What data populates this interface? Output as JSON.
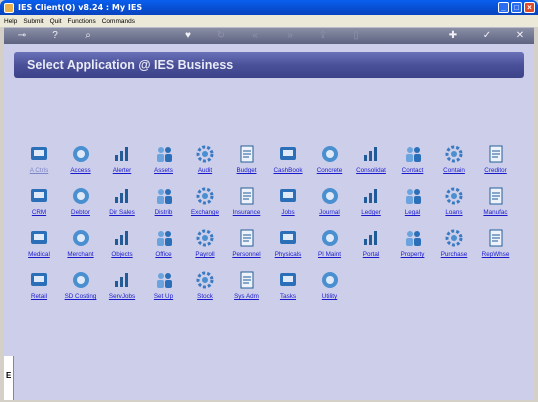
{
  "window": {
    "title": "IES Client(Q) v8.24 : My IES"
  },
  "menu": {
    "items": [
      "Help",
      "Submit",
      "Quit",
      "Functions",
      "Commands"
    ]
  },
  "header": {
    "title": "Select Application @ IES Business"
  },
  "side": {
    "label": "E"
  },
  "apps": [
    {
      "label": "A Ctrls",
      "icon": "a-ctrls-icon",
      "enabled": false
    },
    {
      "label": "Access",
      "icon": "access-icon",
      "enabled": true
    },
    {
      "label": "Alerter",
      "icon": "alerter-icon",
      "enabled": true
    },
    {
      "label": "Assets",
      "icon": "assets-icon",
      "enabled": true
    },
    {
      "label": "Audit",
      "icon": "audit-icon",
      "enabled": true
    },
    {
      "label": "Budget",
      "icon": "budget-icon",
      "enabled": true
    },
    {
      "label": "CashBook",
      "icon": "cashbook-icon",
      "enabled": true
    },
    {
      "label": "Concrete",
      "icon": "concrete-icon",
      "enabled": true
    },
    {
      "label": "Consolidat",
      "icon": "consolidat-icon",
      "enabled": true
    },
    {
      "label": "Contact",
      "icon": "contact-icon",
      "enabled": true
    },
    {
      "label": "Contain",
      "icon": "contain-icon",
      "enabled": true
    },
    {
      "label": "Creditor",
      "icon": "creditor-icon",
      "enabled": true
    },
    {
      "label": "CRM",
      "icon": "crm-icon",
      "enabled": true
    },
    {
      "label": "Debtor",
      "icon": "debtor-icon",
      "enabled": true
    },
    {
      "label": "Dir Sales",
      "icon": "dir-sales-icon",
      "enabled": true
    },
    {
      "label": "Distrib",
      "icon": "distrib-icon",
      "enabled": true
    },
    {
      "label": "Exchange",
      "icon": "exchange-icon",
      "enabled": true
    },
    {
      "label": "Insurance",
      "icon": "insurance-icon",
      "enabled": true
    },
    {
      "label": "Jobs",
      "icon": "jobs-icon",
      "enabled": true
    },
    {
      "label": "Journal",
      "icon": "journal-icon",
      "enabled": true
    },
    {
      "label": "Ledger",
      "icon": "ledger-icon",
      "enabled": true
    },
    {
      "label": "Legal",
      "icon": "legal-icon",
      "enabled": true
    },
    {
      "label": "Loans",
      "icon": "loans-icon",
      "enabled": true
    },
    {
      "label": "Manufac",
      "icon": "manufac-icon",
      "enabled": true
    },
    {
      "label": "Medical",
      "icon": "medical-icon",
      "enabled": true
    },
    {
      "label": "Merchant",
      "icon": "merchant-icon",
      "enabled": true
    },
    {
      "label": "Objects",
      "icon": "objects-icon",
      "enabled": true
    },
    {
      "label": "Office",
      "icon": "office-icon",
      "enabled": true
    },
    {
      "label": "Payroll",
      "icon": "payroll-icon",
      "enabled": true
    },
    {
      "label": "Personnel",
      "icon": "personnel-icon",
      "enabled": true
    },
    {
      "label": "Physicals",
      "icon": "physicals-icon",
      "enabled": true
    },
    {
      "label": "PI Maint",
      "icon": "pi-maint-icon",
      "enabled": true
    },
    {
      "label": "Portal",
      "icon": "portal-icon",
      "enabled": true
    },
    {
      "label": "Property",
      "icon": "property-icon",
      "enabled": true
    },
    {
      "label": "Purchase",
      "icon": "purchase-icon",
      "enabled": true
    },
    {
      "label": "RepWhse",
      "icon": "repwhse-icon",
      "enabled": true
    },
    {
      "label": "Retail",
      "icon": "retail-icon",
      "enabled": true
    },
    {
      "label": "SD Costing",
      "icon": "sd-costing-icon",
      "enabled": true
    },
    {
      "label": "ServJobs",
      "icon": "servjobs-icon",
      "enabled": true
    },
    {
      "label": "Set Up",
      "icon": "set-up-icon",
      "enabled": true
    },
    {
      "label": "Stock",
      "icon": "stock-icon",
      "enabled": true
    },
    {
      "label": "Sys Adm",
      "icon": "sys-adm-icon",
      "enabled": true
    },
    {
      "label": "Tasks",
      "icon": "tasks-icon",
      "enabled": true
    },
    {
      "label": "Utility",
      "icon": "utility-icon",
      "enabled": true
    }
  ],
  "colors": {
    "header": "#4a5199",
    "panel": "#cdcfea",
    "link": "#1a1acc",
    "toolbar": "#5d6280"
  }
}
